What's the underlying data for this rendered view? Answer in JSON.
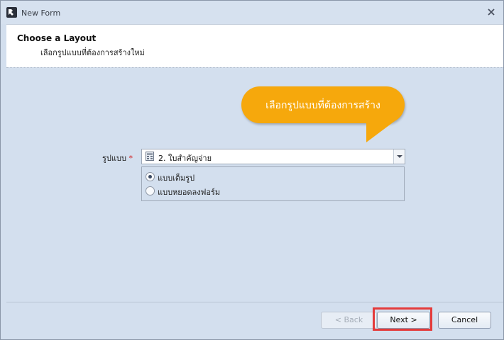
{
  "window": {
    "title": "New Form",
    "app_icon": "app-logo-icon",
    "close_icon": "close-icon"
  },
  "header": {
    "title": "Choose a Layout",
    "subtitle": "เลือกรูปแบบที่ต้องการสร้างใหม่"
  },
  "callout": {
    "text": "เลือกรูปแบบที่ต้องการสร้าง",
    "color": "#f6a80c"
  },
  "form": {
    "field_label": "รูปแบบ",
    "required_mark": "*",
    "combo_value": "2. ใบสำคัญจ่าย",
    "radio_options": [
      {
        "label": "แบบเต็มรูป",
        "selected": true
      },
      {
        "label": "แบบหยอดลงฟอร์ม",
        "selected": false
      }
    ]
  },
  "footer": {
    "back_label": "< Back",
    "next_label": "Next >",
    "cancel_label": "Cancel"
  },
  "colors": {
    "highlight": "#e43b3b",
    "background": "#d3dfee"
  }
}
